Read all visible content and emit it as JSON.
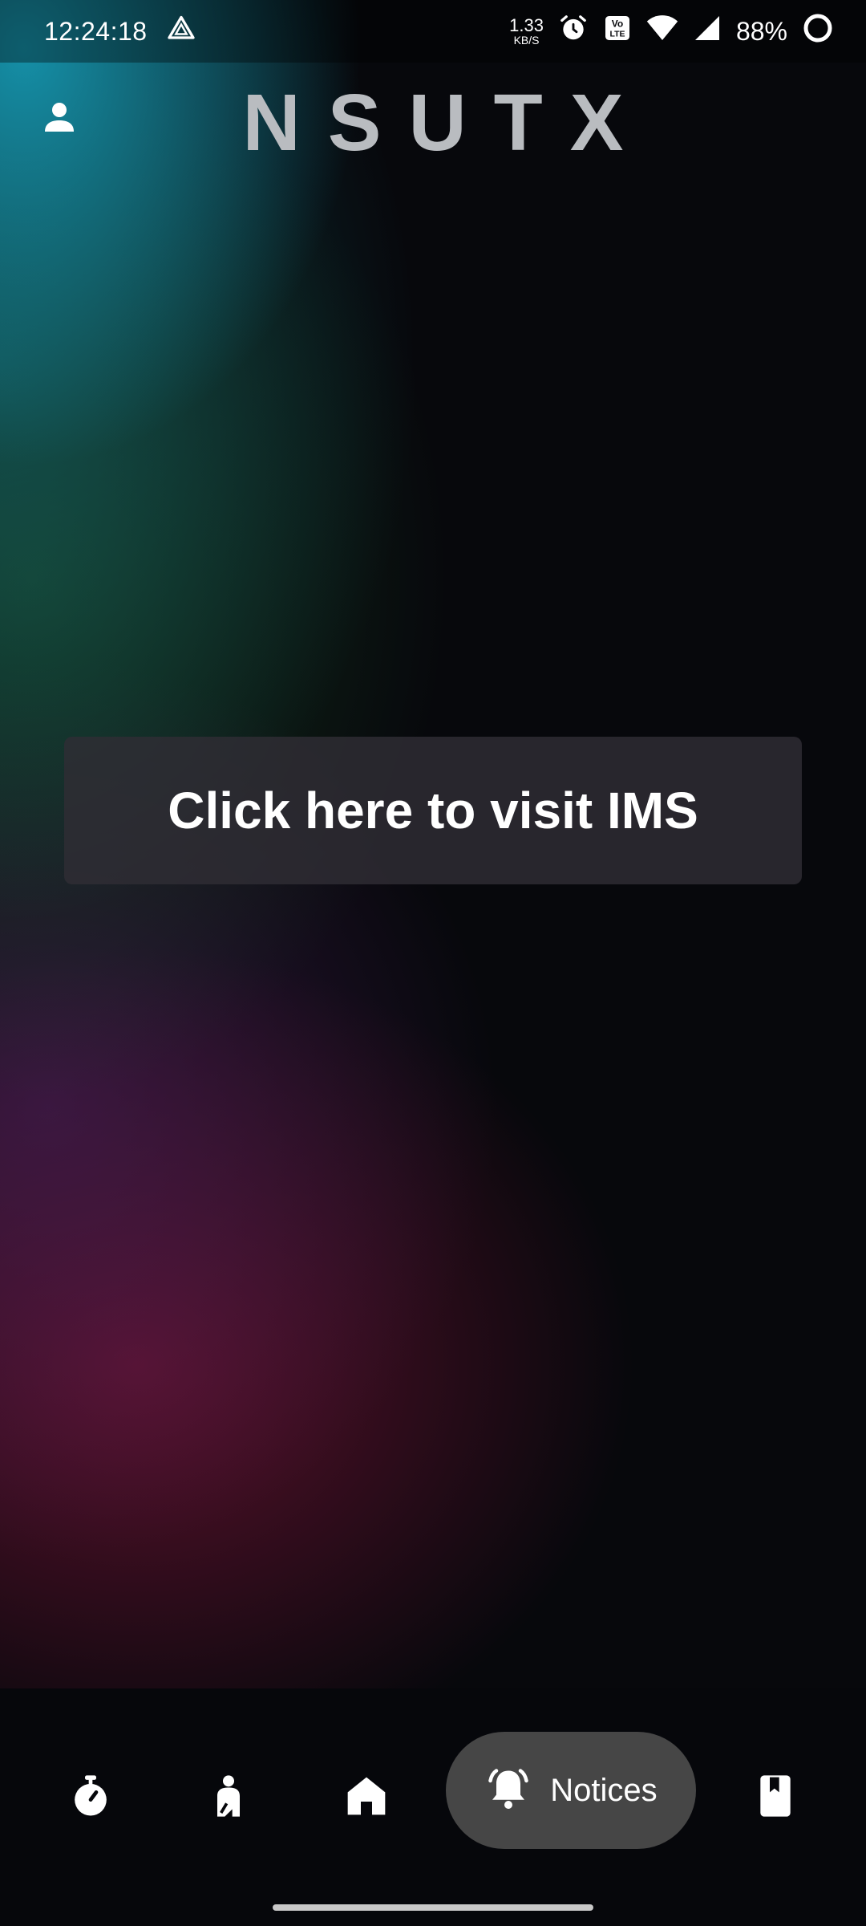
{
  "status_bar": {
    "time": "12:24:18",
    "net_speed_value": "1.33",
    "net_speed_unit": "KB/S",
    "battery": "88%",
    "icons": [
      "drive-icon",
      "alarm-icon",
      "volte-icon",
      "wifi-icon",
      "signal-icon",
      "battery-ring-icon"
    ]
  },
  "header": {
    "title": "NSUTX",
    "profile_icon": "person-icon"
  },
  "main": {
    "ims_button_label": "Click here to visit IMS"
  },
  "bottom_nav": {
    "items": [
      {
        "icon": "stopwatch-icon"
      },
      {
        "icon": "student-icon"
      },
      {
        "icon": "home-icon"
      },
      {
        "icon": "bell-icon",
        "label": "Notices",
        "active": true
      },
      {
        "icon": "bookmark-icon"
      }
    ]
  },
  "colors": {
    "background": "#07080c",
    "title": "#b9bcc0",
    "button_bg": "#302d34",
    "active_tab_bg": "#464646",
    "gradient_teal": "#1696af",
    "gradient_green": "#1e5a2d",
    "gradient_purple": "#461e55",
    "gradient_crimson": "#781437"
  }
}
